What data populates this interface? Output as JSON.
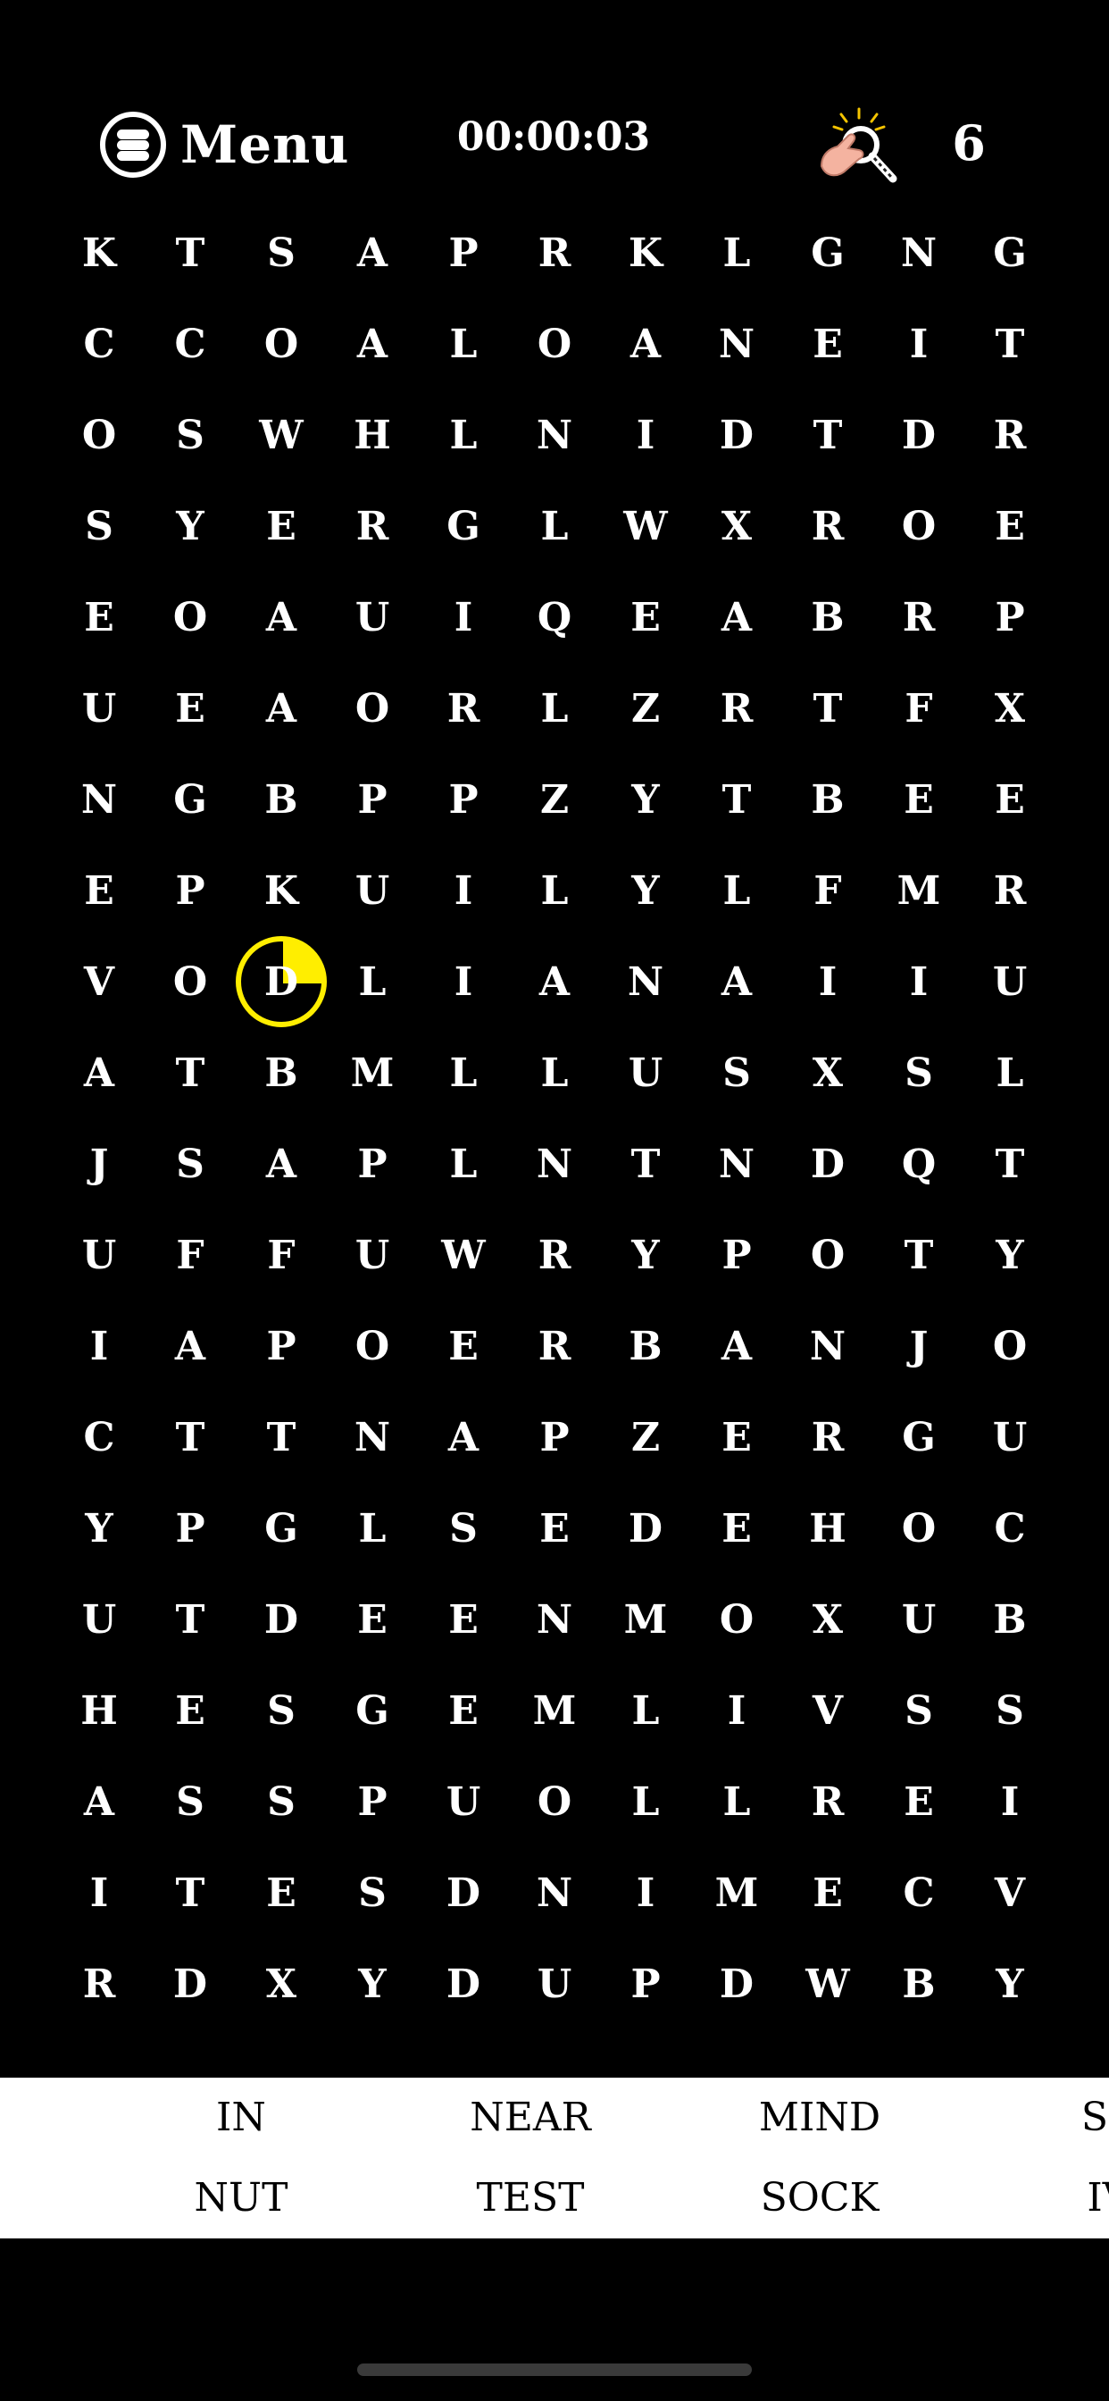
{
  "header": {
    "menu_label": "Menu",
    "timer": "00:00:03",
    "hints_count": "6",
    "menu_icon": "menu-icon",
    "hint_icon": "hint-magnifier-icon"
  },
  "grid": [
    [
      "K",
      "T",
      "S",
      "A",
      "P",
      "R",
      "K",
      "L",
      "G",
      "N",
      "G"
    ],
    [
      "C",
      "C",
      "O",
      "A",
      "L",
      "O",
      "A",
      "N",
      "E",
      "I",
      "T"
    ],
    [
      "O",
      "S",
      "W",
      "H",
      "L",
      "N",
      "I",
      "D",
      "T",
      "D",
      "R"
    ],
    [
      "S",
      "Y",
      "E",
      "R",
      "G",
      "L",
      "W",
      "X",
      "R",
      "O",
      "E"
    ],
    [
      "E",
      "O",
      "A",
      "U",
      "I",
      "Q",
      "E",
      "A",
      "B",
      "R",
      "P"
    ],
    [
      "U",
      "E",
      "A",
      "O",
      "R",
      "L",
      "Z",
      "R",
      "T",
      "F",
      "X"
    ],
    [
      "N",
      "G",
      "B",
      "P",
      "P",
      "Z",
      "Y",
      "T",
      "B",
      "E",
      "E"
    ],
    [
      "E",
      "P",
      "K",
      "U",
      "I",
      "L",
      "Y",
      "L",
      "F",
      "M",
      "R"
    ],
    [
      "V",
      "O",
      "D",
      "L",
      "I",
      "A",
      "N",
      "A",
      "I",
      "I",
      "U"
    ],
    [
      "A",
      "T",
      "B",
      "M",
      "L",
      "L",
      "U",
      "S",
      "X",
      "S",
      "L"
    ],
    [
      "J",
      "S",
      "A",
      "P",
      "L",
      "N",
      "T",
      "N",
      "D",
      "Q",
      "T"
    ],
    [
      "U",
      "F",
      "F",
      "U",
      "W",
      "R",
      "Y",
      "P",
      "O",
      "T",
      "Y"
    ],
    [
      "I",
      "A",
      "P",
      "O",
      "E",
      "R",
      "B",
      "A",
      "N",
      "J",
      "O"
    ],
    [
      "C",
      "T",
      "T",
      "N",
      "A",
      "P",
      "Z",
      "E",
      "R",
      "G",
      "U"
    ],
    [
      "Y",
      "P",
      "G",
      "L",
      "S",
      "E",
      "D",
      "E",
      "H",
      "O",
      "C"
    ],
    [
      "U",
      "T",
      "D",
      "E",
      "E",
      "N",
      "M",
      "O",
      "X",
      "U",
      "B"
    ],
    [
      "H",
      "E",
      "S",
      "G",
      "E",
      "M",
      "L",
      "I",
      "V",
      "S",
      "S"
    ],
    [
      "A",
      "S",
      "S",
      "P",
      "U",
      "O",
      "L",
      "L",
      "R",
      "E",
      "I"
    ],
    [
      "I",
      "T",
      "E",
      "S",
      "D",
      "N",
      "I",
      "M",
      "E",
      "C",
      "V"
    ],
    [
      "R",
      "D",
      "X",
      "Y",
      "D",
      "U",
      "P",
      "D",
      "W",
      "B",
      "Y"
    ]
  ],
  "selected_cell": {
    "row": 8,
    "col": 2
  },
  "words": [
    [
      "IN",
      "NUT"
    ],
    [
      "NEAR",
      "TEST"
    ],
    [
      "MIND",
      "SOCK"
    ],
    [
      "SE",
      "IV"
    ]
  ],
  "colors": {
    "background": "#000000",
    "highlight": "#ffee00",
    "wordbar": "#ffffff"
  }
}
